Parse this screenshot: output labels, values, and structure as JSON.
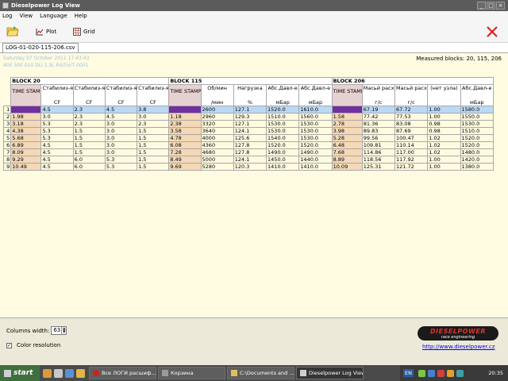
{
  "window": {
    "title": "Dieselpower Log View"
  },
  "menu": [
    "Log",
    "View",
    "Language",
    "Help"
  ],
  "toolbar": {
    "plot_label": "Plot",
    "grid_label": "Grid"
  },
  "tab": {
    "label": "LOG-01-020-115-206.csv"
  },
  "info": {
    "line1": "Saturday 07 October 2011 17:43:43",
    "line2": "400 500 010 DLI 1.9L R4/5V/T         0001"
  },
  "measured": "Measured blocks: 20, 115, 206",
  "blocks": {
    "b20": "BLOCK 20",
    "b115": "BLOCK 115",
    "b206": "BLOCK 206"
  },
  "headers": [
    {
      "top": "TIME STAMP",
      "bot": ""
    },
    {
      "top": "Стабилиз-я ХХ",
      "bot": "CF"
    },
    {
      "top": "Стабилиз-я ХХ",
      "bot": "CF"
    },
    {
      "top": "Стабилиз-я ХХ",
      "bot": "CF"
    },
    {
      "top": "Стабилиз-я ХХ",
      "bot": "CF"
    },
    {
      "top": "TIME STAMP",
      "bot": ""
    },
    {
      "top": "Об/мин",
      "bot": "/мин"
    },
    {
      "top": "Нагрузка",
      "bot": "%"
    },
    {
      "top": "Абс.Давл-е",
      "bot": "мБар"
    },
    {
      "top": "Абс.Давл-е",
      "bot": "мБар"
    },
    {
      "top": "TIME STAMP",
      "bot": ""
    },
    {
      "top": "Масьй расход",
      "bot": "г/с"
    },
    {
      "top": "Масьй расход",
      "bot": "г/с"
    },
    {
      "top": "(нет узла)",
      "bot": ""
    },
    {
      "top": "Абс.Давл-е",
      "bot": "мБар"
    }
  ],
  "rows": [
    {
      "n": "1",
      "cells": [
        "0.70",
        "4.5",
        "2.3",
        "4.5",
        "3.8",
        "0.07",
        "2600",
        "127.1",
        "1520.0",
        "1610.0",
        "0.20",
        "67.19",
        "67.72",
        "1.00",
        "1580.0"
      ]
    },
    {
      "n": "2",
      "cells": [
        "1.98",
        "3.0",
        "2.3",
        "4.5",
        "3.0",
        "1.18",
        "2960",
        "129.3",
        "1510.0",
        "1560.0",
        "1.58",
        "77.42",
        "77.53",
        "1.00",
        "1550.0"
      ]
    },
    {
      "n": "3",
      "cells": [
        "3.18",
        "5.3",
        "2.3",
        "3.0",
        "2.3",
        "2.38",
        "3320",
        "127.1",
        "1530.0",
        "1530.0",
        "2.78",
        "81.36",
        "83.08",
        "0.98",
        "1530.0"
      ]
    },
    {
      "n": "4",
      "cells": [
        "4.38",
        "5.3",
        "1.5",
        "3.0",
        "1.5",
        "3.58",
        "3640",
        "124.1",
        "1530.0",
        "1530.0",
        "3.98",
        "89.83",
        "87.69",
        "0.98",
        "1510.0"
      ]
    },
    {
      "n": "5",
      "cells": [
        "5.68",
        "5.3",
        "1.5",
        "3.0",
        "1.5",
        "4.78",
        "4000",
        "125.6",
        "1540.0",
        "1530.0",
        "5.28",
        "99.56",
        "100.47",
        "1.02",
        "1520.0"
      ]
    },
    {
      "n": "6",
      "cells": [
        "6.89",
        "4.5",
        "1.5",
        "3.0",
        "1.5",
        "6.08",
        "4360",
        "127.8",
        "1520.0",
        "1520.0",
        "6.48",
        "109.81",
        "110.14",
        "1.02",
        "1520.0"
      ]
    },
    {
      "n": "7",
      "cells": [
        "8.09",
        "4.5",
        "1.5",
        "3.0",
        "1.5",
        "7.28",
        "4680",
        "127.8",
        "1490.0",
        "1490.0",
        "7.68",
        "114.86",
        "117.00",
        "1.02",
        "1480.0"
      ]
    },
    {
      "n": "8",
      "cells": [
        "9.29",
        "4.5",
        "6.0",
        "5.3",
        "1.5",
        "8.49",
        "5000",
        "124.1",
        "1450.0",
        "1440.0",
        "8.89",
        "118.56",
        "117.92",
        "1.00",
        "1420.0"
      ]
    },
    {
      "n": "9",
      "cells": [
        "10.49",
        "4.5",
        "6.0",
        "5.3",
        "1.5",
        "9.69",
        "5280",
        "120.3",
        "1410.0",
        "1410.0",
        "10.09",
        "125.31",
        "121.72",
        "1.00",
        "1380.0"
      ]
    }
  ],
  "bottom": {
    "columns_width_label": "Columns width:",
    "columns_width_value": "63",
    "color_resolution_label": "Color resolution",
    "logo_line1": "DIESELPOWER",
    "logo_line2": "race engineering",
    "link": "http://www.dieselpower.cz"
  },
  "taskbar": {
    "start": "start",
    "tasks": [
      "Все ЛОГИ расшиф...",
      "Корзина",
      "C:\\Documents and ...",
      "Dieselpower Log View"
    ],
    "lang": "EN",
    "clock": "20:35"
  },
  "colors": {
    "timestamp_bg": "#f5d9b6",
    "timestamp_header_bg": "#e6d1d1",
    "cell_bg": "#fffbe0",
    "selected_row": "#b9d9f5",
    "selected_marker": "#7030a0",
    "close_x": "#e02020"
  }
}
